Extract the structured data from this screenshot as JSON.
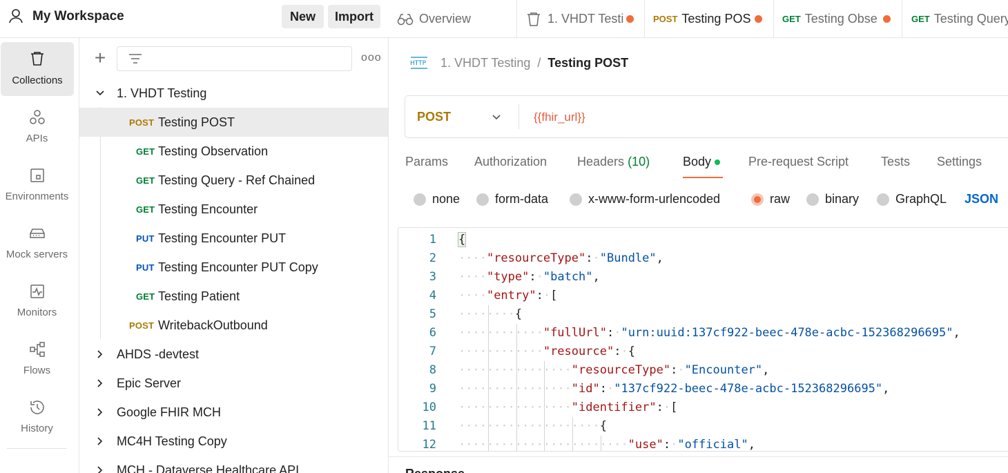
{
  "workspace": {
    "title": "My Workspace",
    "new_label": "New",
    "import_label": "Import"
  },
  "rail": {
    "items": [
      {
        "label": "Collections",
        "icon": "trash-can-icon"
      },
      {
        "label": "APIs",
        "icon": "apis-icon"
      },
      {
        "label": "Environments",
        "icon": "environment-icon"
      },
      {
        "label": "Mock servers",
        "icon": "server-icon"
      },
      {
        "label": "Monitors",
        "icon": "monitor-icon"
      },
      {
        "label": "Flows",
        "icon": "flows-icon"
      },
      {
        "label": "History",
        "icon": "history-icon"
      }
    ]
  },
  "collections": {
    "more_label": "ooo",
    "plus_label": "+",
    "tree": [
      {
        "type": "folder",
        "label": "1. VHDT Testing",
        "expanded": true
      },
      {
        "type": "request",
        "method": "POST",
        "label": "Testing POST",
        "selected": true
      },
      {
        "type": "request",
        "method": "GET",
        "label": "Testing Observation"
      },
      {
        "type": "request",
        "method": "GET",
        "label": "Testing Query - Ref Chained"
      },
      {
        "type": "request",
        "method": "GET",
        "label": "Testing Encounter"
      },
      {
        "type": "request",
        "method": "PUT",
        "label": "Testing Encounter PUT"
      },
      {
        "type": "request",
        "method": "PUT",
        "label": "Testing Encounter PUT Copy"
      },
      {
        "type": "request",
        "method": "GET",
        "label": "Testing Patient"
      },
      {
        "type": "request",
        "method": "POST",
        "label": "WritebackOutbound"
      },
      {
        "type": "folder",
        "label": "AHDS -devtest",
        "expanded": false
      },
      {
        "type": "folder",
        "label": "Epic Server",
        "expanded": false
      },
      {
        "type": "folder",
        "label": "Google FHIR MCH",
        "expanded": false
      },
      {
        "type": "folder",
        "label": "MC4H Testing Copy",
        "expanded": false
      },
      {
        "type": "folder",
        "label": "MCH - Dataverse Healthcare API",
        "expanded": false
      }
    ]
  },
  "tabs": [
    {
      "label": "Overview",
      "icon": "overview-icon"
    },
    {
      "label": "1. VHDT Testi",
      "icon": "collection-icon",
      "unsaved": true
    },
    {
      "method": "POST",
      "label": "Testing POS",
      "unsaved": true,
      "active": true
    },
    {
      "method": "GET",
      "label": "Testing Obse",
      "unsaved": true
    },
    {
      "method": "GET",
      "label": "Testing Query"
    }
  ],
  "breadcrumb": {
    "icon": "http-icon",
    "icon_text": "HTTP",
    "parent": "1. VHDT Testing",
    "separator": "/",
    "current": "Testing POST"
  },
  "request": {
    "method": "POST",
    "url": "{{fhir_url}}"
  },
  "request_tabs": [
    {
      "label": "Params"
    },
    {
      "label": "Authorization"
    },
    {
      "label": "Headers",
      "count": "(10)"
    },
    {
      "label": "Body",
      "active": true
    },
    {
      "label": "Pre-request Script"
    },
    {
      "label": "Tests"
    },
    {
      "label": "Settings"
    }
  ],
  "body_types": [
    {
      "label": "none"
    },
    {
      "label": "form-data"
    },
    {
      "label": "x-www-form-urlencoded"
    },
    {
      "label": "raw",
      "checked": true
    },
    {
      "label": "binary"
    },
    {
      "label": "GraphQL"
    }
  ],
  "body_format": "JSON",
  "editor": {
    "lines": [
      {
        "n": "1",
        "indent": 0,
        "tokens": [
          [
            "p",
            "{"
          ]
        ]
      },
      {
        "n": "2",
        "indent": 1,
        "tokens": [
          [
            "k",
            "\"resourceType\""
          ],
          [
            "p",
            ":"
          ],
          [
            "ws",
            "·"
          ],
          [
            "s",
            "\"Bundle\""
          ],
          [
            "p",
            ","
          ]
        ]
      },
      {
        "n": "3",
        "indent": 1,
        "tokens": [
          [
            "k",
            "\"type\""
          ],
          [
            "p",
            ":"
          ],
          [
            "ws",
            "·"
          ],
          [
            "s",
            "\"batch\""
          ],
          [
            "p",
            ","
          ]
        ]
      },
      {
        "n": "4",
        "indent": 1,
        "tokens": [
          [
            "k",
            "\"entry\""
          ],
          [
            "p",
            ":"
          ],
          [
            "ws",
            "·"
          ],
          [
            "p",
            "["
          ]
        ]
      },
      {
        "n": "5",
        "indent": 2,
        "tokens": [
          [
            "p",
            "{"
          ]
        ]
      },
      {
        "n": "6",
        "indent": 3,
        "tokens": [
          [
            "k",
            "\"fullUrl\""
          ],
          [
            "p",
            ":"
          ],
          [
            "ws",
            "·"
          ],
          [
            "s",
            "\"urn:uuid:137cf922-beec-478e-acbc-152368296695\""
          ],
          [
            "p",
            ","
          ]
        ]
      },
      {
        "n": "7",
        "indent": 3,
        "tokens": [
          [
            "k",
            "\"resource\""
          ],
          [
            "p",
            ":"
          ],
          [
            "ws",
            "·"
          ],
          [
            "p",
            "{"
          ]
        ]
      },
      {
        "n": "8",
        "indent": 4,
        "tokens": [
          [
            "k",
            "\"resourceType\""
          ],
          [
            "p",
            ":"
          ],
          [
            "ws",
            "·"
          ],
          [
            "s",
            "\"Encounter\""
          ],
          [
            "p",
            ","
          ]
        ]
      },
      {
        "n": "9",
        "indent": 4,
        "tokens": [
          [
            "k",
            "\"id\""
          ],
          [
            "p",
            ":"
          ],
          [
            "ws",
            "·"
          ],
          [
            "s",
            "\"137cf922-beec-478e-acbc-152368296695\""
          ],
          [
            "p",
            ","
          ]
        ]
      },
      {
        "n": "10",
        "indent": 4,
        "tokens": [
          [
            "k",
            "\"identifier\""
          ],
          [
            "p",
            ":"
          ],
          [
            "ws",
            "·"
          ],
          [
            "p",
            "["
          ]
        ]
      },
      {
        "n": "11",
        "indent": 5,
        "tokens": [
          [
            "p",
            "{"
          ]
        ]
      },
      {
        "n": "12",
        "indent": 6,
        "tokens": [
          [
            "k",
            "\"use\""
          ],
          [
            "p",
            ":"
          ],
          [
            "ws",
            "·"
          ],
          [
            "s",
            "\"official\""
          ],
          [
            "p",
            ","
          ]
        ]
      }
    ]
  },
  "response": {
    "label": "Response"
  },
  "colors": {
    "post": "#ad7a03",
    "get": "#007f31",
    "put": "#0053b8",
    "accent": "#f26b3a",
    "json_link": "#0265d2"
  }
}
